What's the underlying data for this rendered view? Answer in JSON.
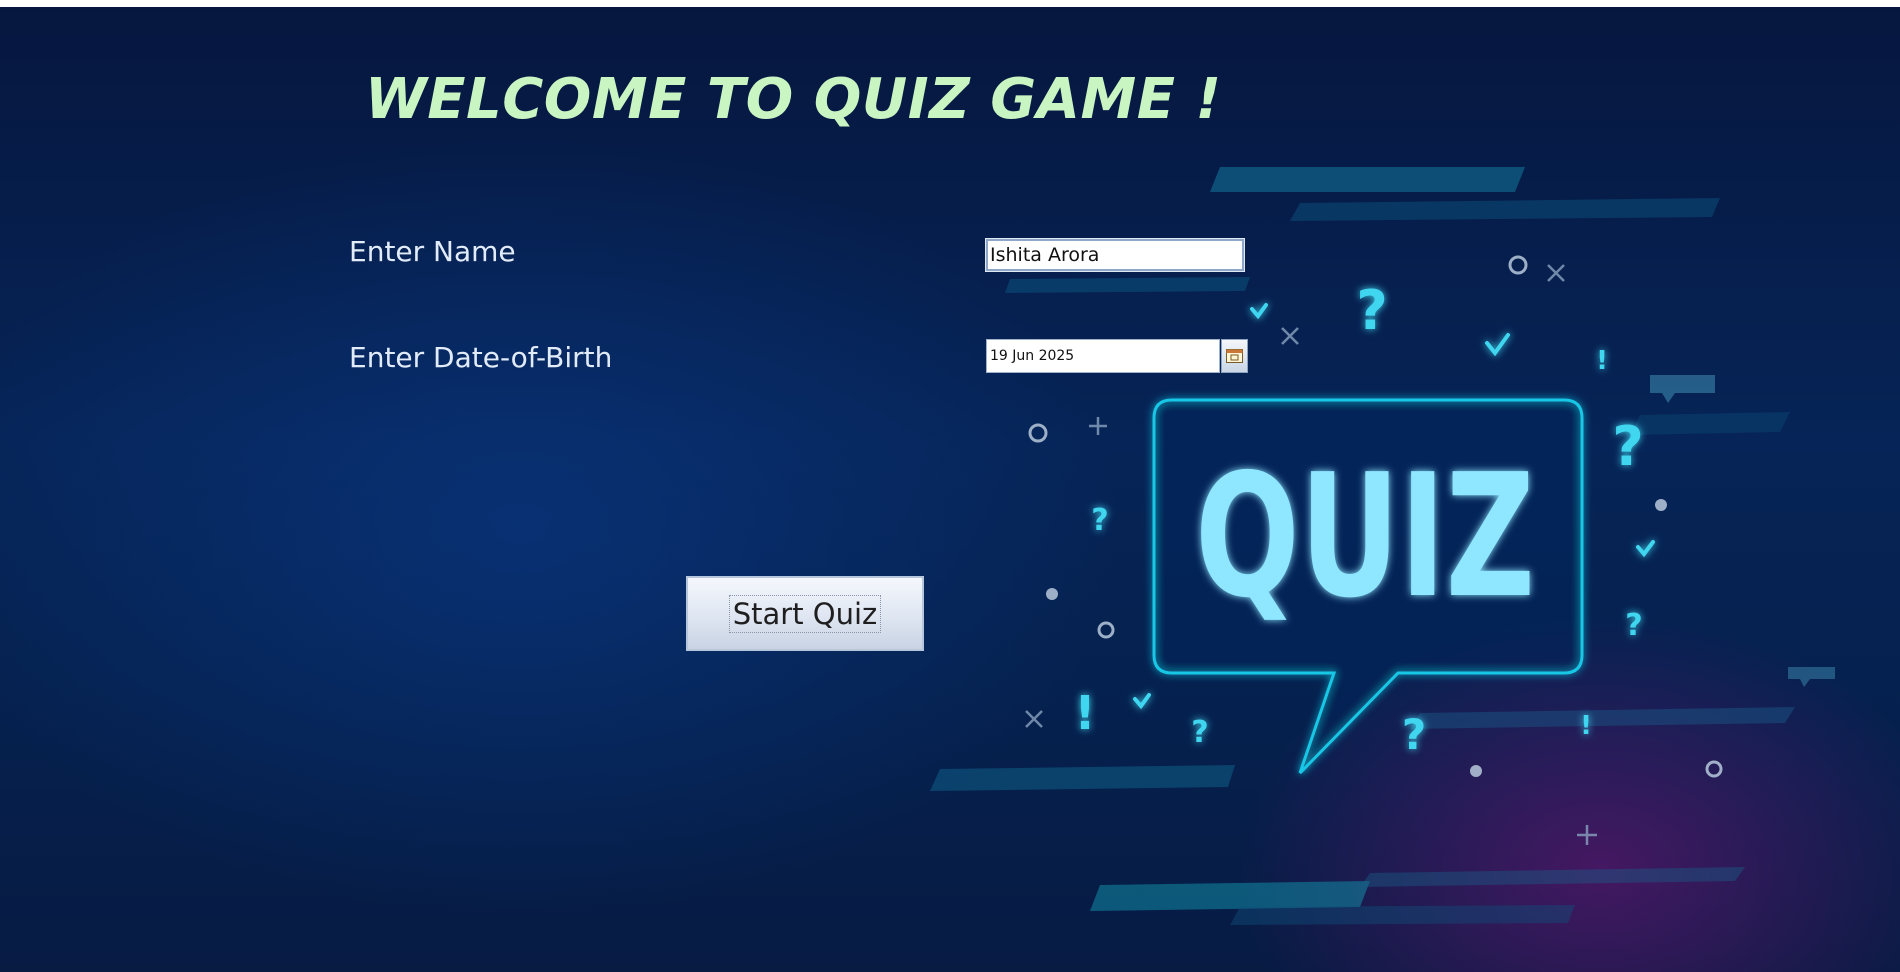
{
  "heading": {
    "title": "WELCOME TO QUIZ GAME !"
  },
  "form": {
    "name_label": "Enter Name",
    "name_value": "Ishita Arora",
    "dob_label": "Enter Date-of-Birth",
    "dob_value": "19 Jun 2025",
    "calendar_icon": "calendar-icon",
    "start_button_label": "Start Quiz"
  },
  "illustration": {
    "bubble_text": "QUIZ",
    "colors": {
      "accent": "#8ee6ff",
      "glow": "#19c7e6",
      "title": "#c9f5c2"
    }
  }
}
